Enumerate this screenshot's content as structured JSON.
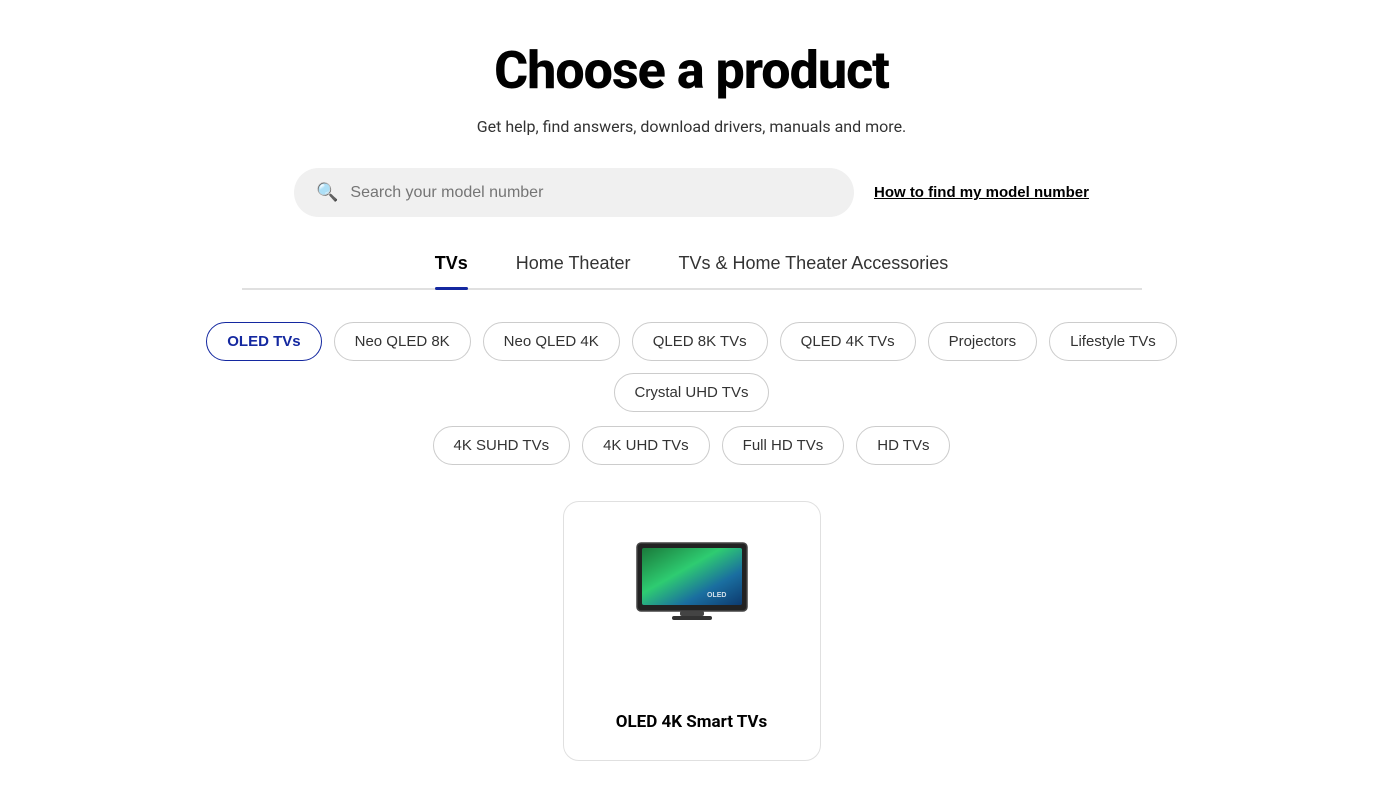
{
  "page": {
    "title": "Choose a product",
    "subtitle": "Get help, find answers, download drivers, manuals and more.",
    "search_placeholder": "Search your model number",
    "find_model_link": "How to find my model number"
  },
  "tabs": [
    {
      "id": "tvs",
      "label": "TVs",
      "active": true
    },
    {
      "id": "home-theater",
      "label": "Home Theater",
      "active": false
    },
    {
      "id": "accessories",
      "label": "TVs & Home Theater Accessories",
      "active": false
    }
  ],
  "filters_row1": [
    {
      "id": "oled-tvs",
      "label": "OLED TVs",
      "active": true
    },
    {
      "id": "neo-qled-8k",
      "label": "Neo QLED 8K",
      "active": false
    },
    {
      "id": "neo-qled-4k",
      "label": "Neo QLED 4K",
      "active": false
    },
    {
      "id": "qled-8k",
      "label": "QLED 8K TVs",
      "active": false
    },
    {
      "id": "qled-4k",
      "label": "QLED 4K TVs",
      "active": false
    },
    {
      "id": "projectors",
      "label": "Projectors",
      "active": false
    },
    {
      "id": "lifestyle-tvs",
      "label": "Lifestyle TVs",
      "active": false
    },
    {
      "id": "crystal-uhd",
      "label": "Crystal UHD TVs",
      "active": false
    }
  ],
  "filters_row2": [
    {
      "id": "4k-suhd",
      "label": "4K SUHD TVs",
      "active": false
    },
    {
      "id": "4k-uhd",
      "label": "4K UHD TVs",
      "active": false
    },
    {
      "id": "full-hd",
      "label": "Full HD TVs",
      "active": false
    },
    {
      "id": "hd-tvs",
      "label": "HD TVs",
      "active": false
    }
  ],
  "products": [
    {
      "id": "oled-4k-smart",
      "label": "OLED 4K Smart TVs"
    }
  ]
}
